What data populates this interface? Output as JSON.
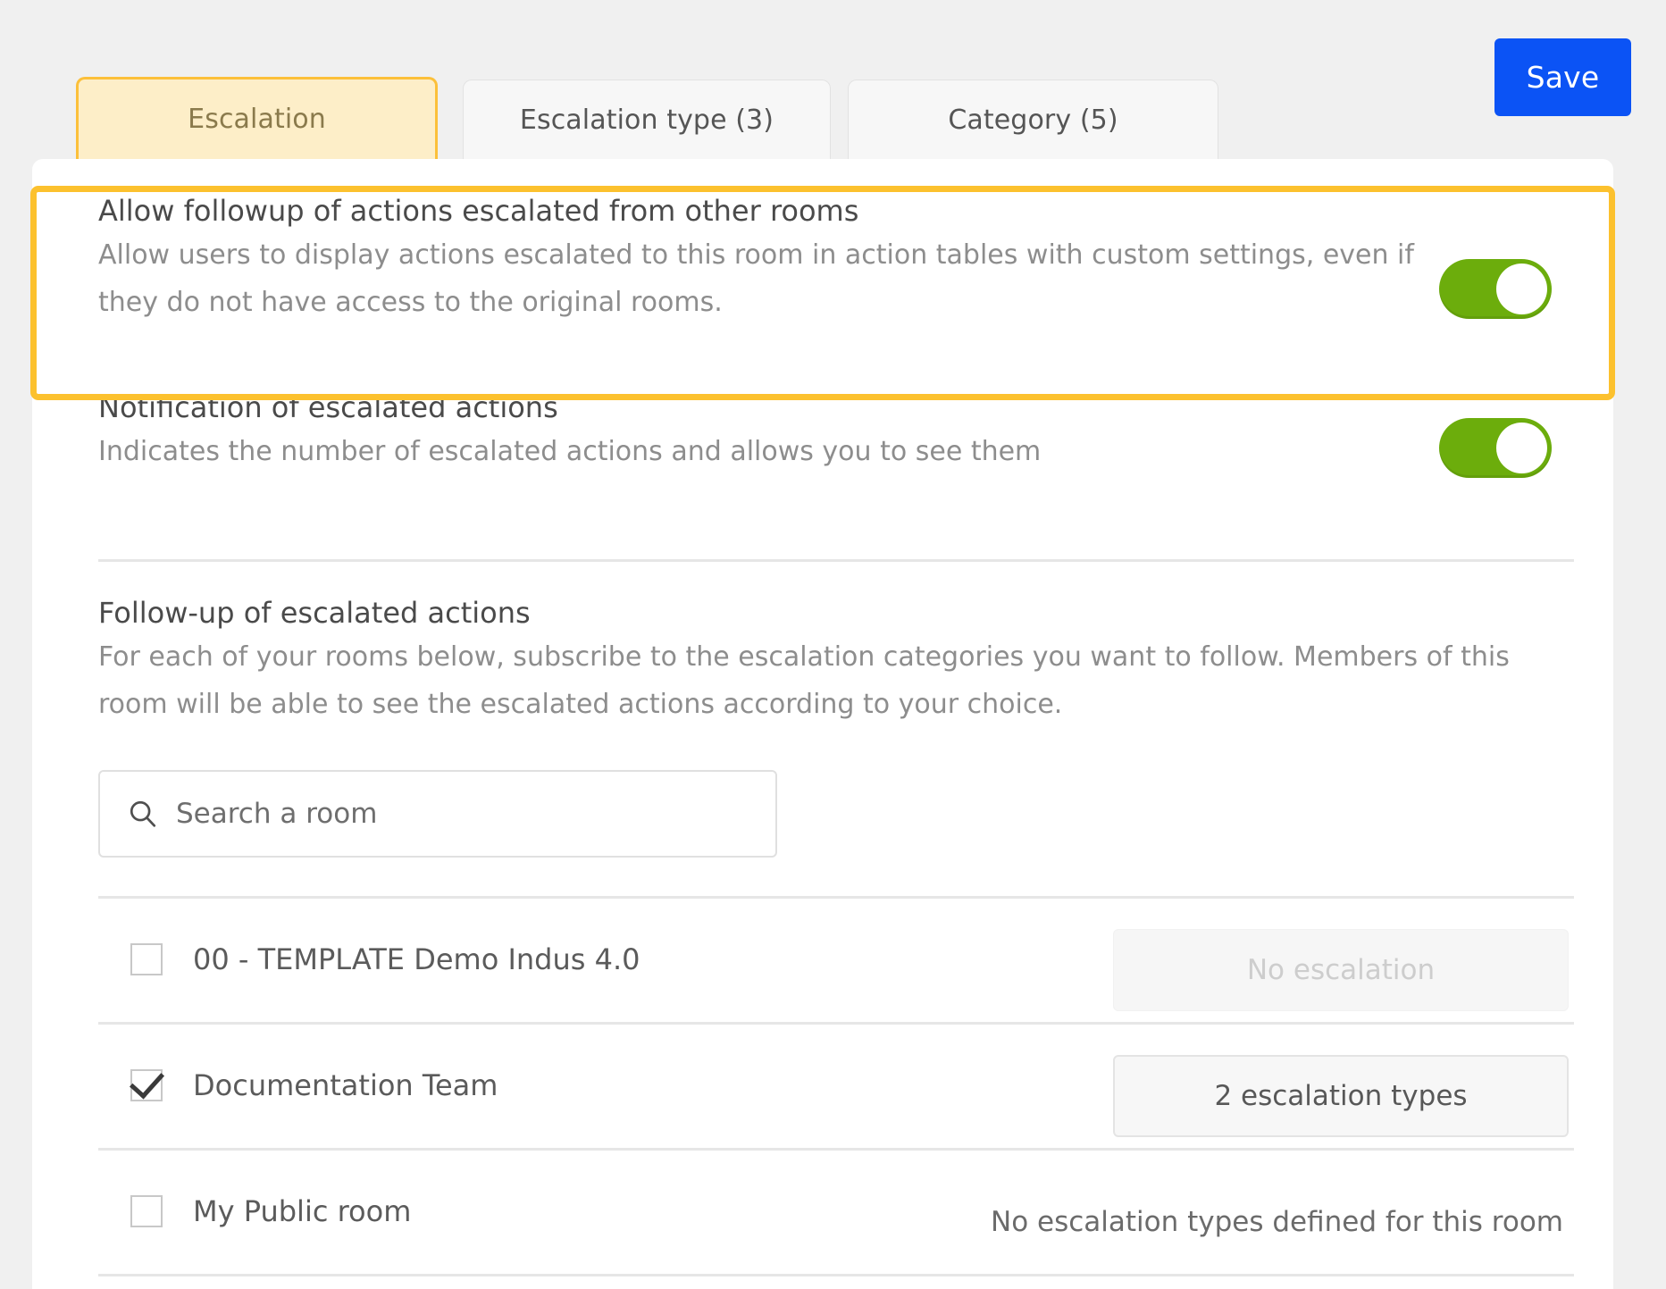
{
  "tabs": [
    {
      "id": "escalation",
      "label": "Escalation",
      "active": true
    },
    {
      "id": "escalation-type",
      "label": "Escalation type (3)",
      "active": false
    },
    {
      "id": "category",
      "label": "Category (5)",
      "active": false
    }
  ],
  "toolbar": {
    "save_label": "Save",
    "save_color": "#0b53f5"
  },
  "highlight": {
    "color": "#fcc12e"
  },
  "settings": [
    {
      "id": "allow-followup",
      "title": "Allow followup of actions escalated from other rooms",
      "description_line1": "Allow users to display actions escalated to this room in action tables with custom settings, even if",
      "description_line2": "they do not have access to the original rooms.",
      "toggle_state": "on",
      "toggle_color": "#6cad0c"
    },
    {
      "id": "notification",
      "title": "Notification of escalated actions",
      "description": "Indicates the number of escalated actions and allows you to see them",
      "toggle_state": "on",
      "toggle_color": "#6cad0c"
    }
  ],
  "follow_up": {
    "title": "Follow-up of escalated actions",
    "description_line1": "For each of your rooms below, subscribe to the escalation categories you want to follow. Members of this",
    "description_line2": "room will be able to see the escalated actions according to your choice.",
    "search": {
      "placeholder": "Search a room",
      "value": "",
      "icon": "search-icon"
    }
  },
  "rooms": [
    {
      "name": "00 - TEMPLATE Demo Indus 4.0",
      "checked": false,
      "action_type": "button",
      "action_label": "No escalation",
      "action_state": "disabled"
    },
    {
      "name": "Documentation Team",
      "checked": true,
      "action_type": "button",
      "action_label": "2 escalation types",
      "action_state": "enabled"
    },
    {
      "name": "My Public room",
      "checked": false,
      "action_type": "text",
      "action_label": "No escalation types defined for this room",
      "action_state": "note"
    }
  ]
}
